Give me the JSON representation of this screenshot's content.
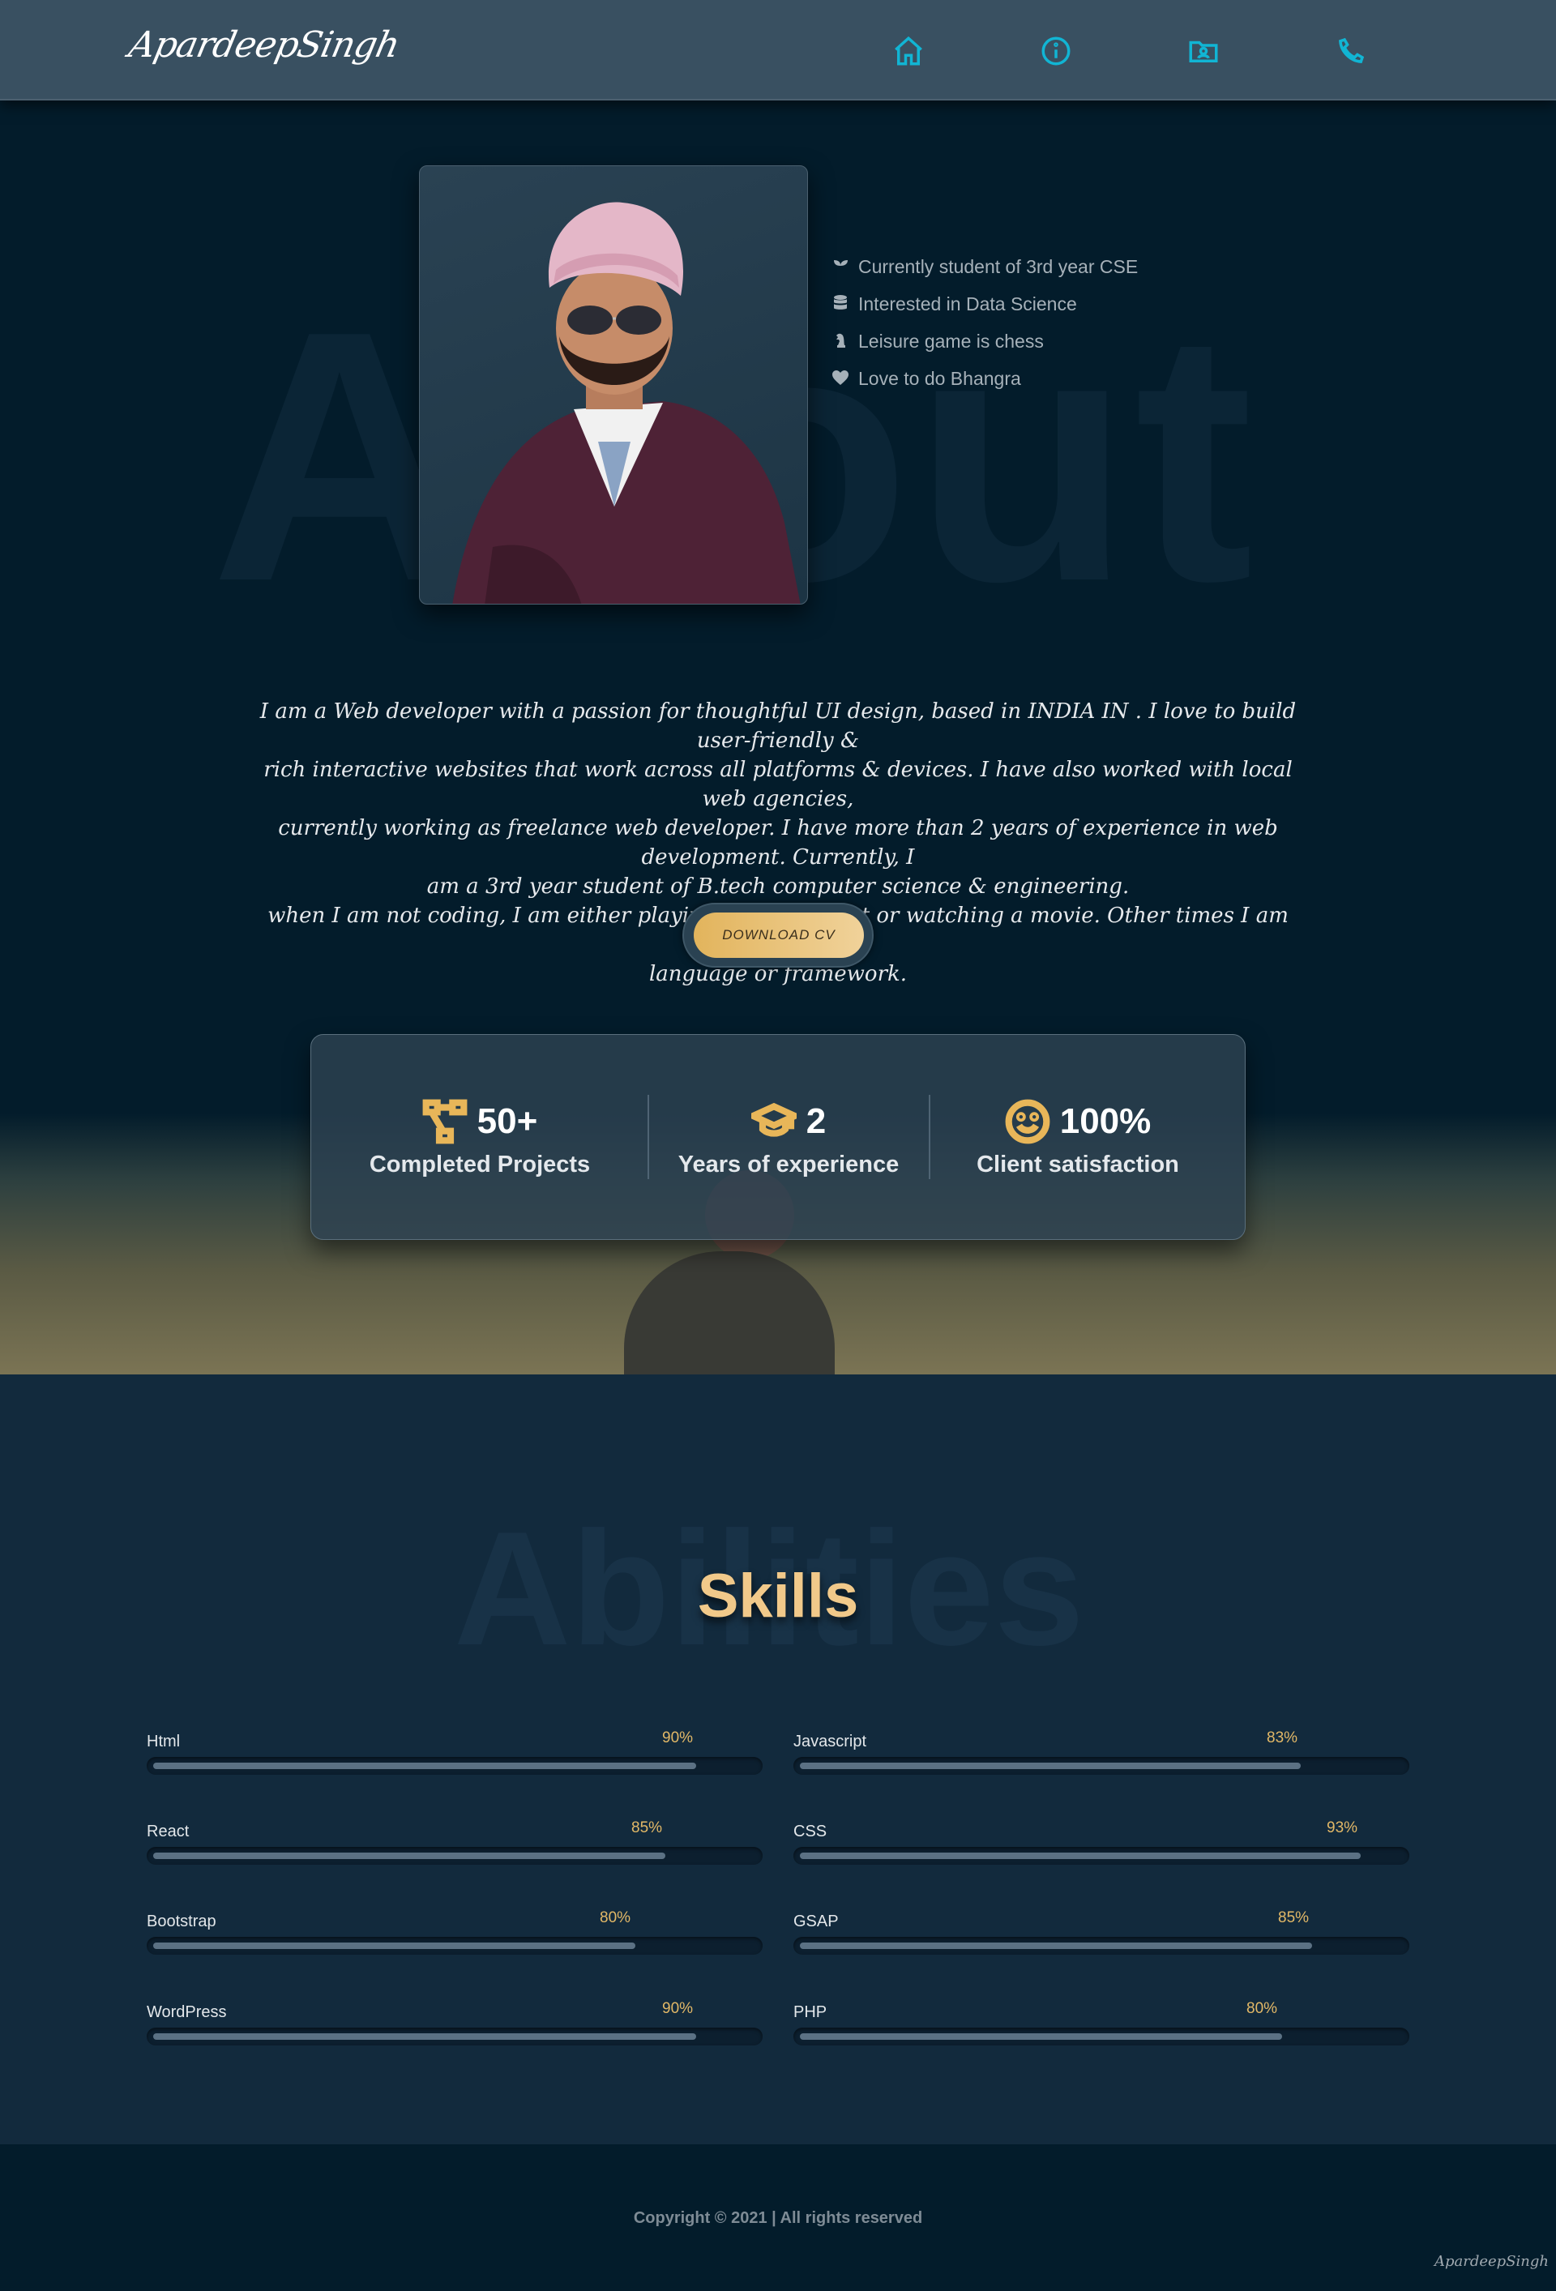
{
  "nav": {
    "logo": "ApardeepSingh",
    "icons": [
      "home-icon",
      "info-icon",
      "folder-user-icon",
      "phone-icon"
    ]
  },
  "about": {
    "background_word": "About",
    "facts": [
      {
        "icon": "seedling-icon",
        "text": "Currently student of 3rd year CSE"
      },
      {
        "icon": "database-icon",
        "text": "Interested in Data Science"
      },
      {
        "icon": "chess-icon",
        "text": "Leisure game is chess"
      },
      {
        "icon": "heart-icon",
        "text": "Love to do Bhangra"
      }
    ],
    "intro_lines": [
      "I am a Web developer with a passion for thoughtful UI design, based in INDIA IN . I love to build user-friendly &",
      "rich interactive websites that work across all platforms & devices. I have also worked with local web agencies,",
      "currently working as freelance web developer. I have more than 2 years of experience in web development. Currently, I",
      "am a 3rd year student of B.tech computer science & engineering.",
      "when I am not coding, I am either playing chess, cricket or watching a movie. Other times I am learning a new",
      "language or framework."
    ],
    "cv_button": "DOWNLOAD CV"
  },
  "stats": [
    {
      "icon": "project-diagram-icon",
      "value": "50+",
      "label": "Completed Projects"
    },
    {
      "icon": "graduation-cap-icon",
      "value": "2",
      "label": "Years of experience"
    },
    {
      "icon": "smile-icon",
      "value": "100%",
      "label": "Client satisfaction"
    }
  ],
  "skills": {
    "background_word": "Abilities",
    "title": "Skills",
    "items": [
      {
        "name": "Html",
        "percent": "90%",
        "level": 90
      },
      {
        "name": "Javascript",
        "percent": "83%",
        "level": 83
      },
      {
        "name": "React",
        "percent": "85%",
        "level": 85
      },
      {
        "name": "CSS",
        "percent": "93%",
        "level": 93
      },
      {
        "name": "Bootstrap",
        "percent": "80%",
        "level": 80
      },
      {
        "name": "GSAP",
        "percent": "85%",
        "level": 85
      },
      {
        "name": "WordPress",
        "percent": "90%",
        "level": 90
      },
      {
        "name": "PHP",
        "percent": "80%",
        "level": 80
      }
    ]
  },
  "footer": {
    "copyright": "Copyright © 2021 | All rights reserved",
    "logo": "ApardeepSingh"
  },
  "colors": {
    "nav_icon": "#11b5d4",
    "accent_gold": "#e8b659",
    "background": "#031c2b"
  }
}
